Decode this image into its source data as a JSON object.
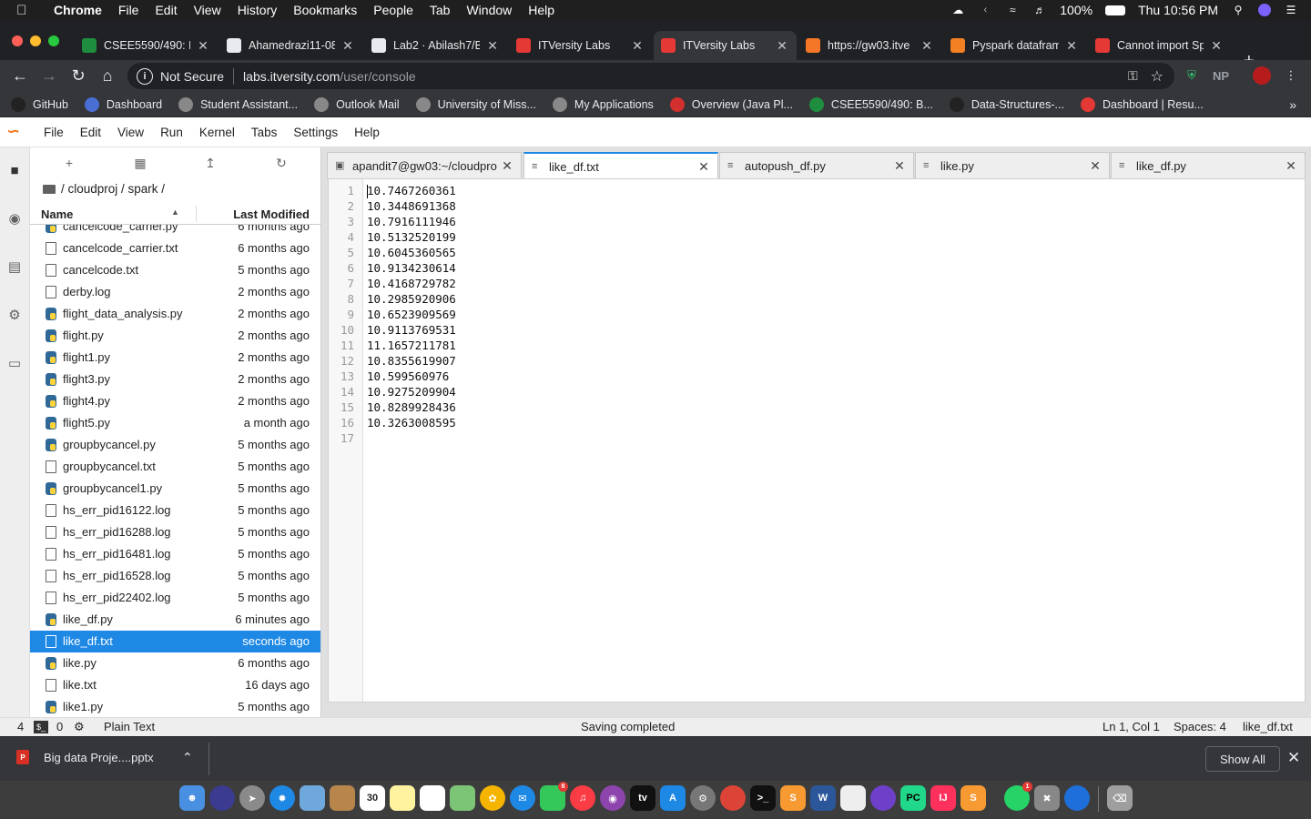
{
  "menubar": {
    "app": "Chrome",
    "items": [
      "File",
      "Edit",
      "View",
      "History",
      "Bookmarks",
      "People",
      "Tab",
      "Window",
      "Help"
    ],
    "battery": "100%",
    "clock": "Thu 10:56 PM"
  },
  "browser": {
    "tabs": [
      {
        "title": "CSEE5590/490: B",
        "favicon": "green-sheet-icon",
        "color": "#1e8e3e"
      },
      {
        "title": "Ahamedrazi11-08",
        "favicon": "github-icon",
        "color": "#e8eaed"
      },
      {
        "title": "Lab2 · Abilash7/B",
        "favicon": "github-icon",
        "color": "#e8eaed"
      },
      {
        "title": "ITVersity Labs",
        "favicon": "itversity-icon",
        "color": "#e53935"
      },
      {
        "title": "ITVersity Labs",
        "favicon": "itversity-icon",
        "color": "#e53935"
      },
      {
        "title": "https://gw03.itve",
        "favicon": "loading-icon",
        "color": "#f37726"
      },
      {
        "title": "Pyspark datafram",
        "favicon": "stackoverflow-icon",
        "color": "#f48024"
      },
      {
        "title": "Cannot import Sp",
        "favicon": "itversity-icon",
        "color": "#e53935"
      }
    ],
    "active_tab_index": 4,
    "address": {
      "security": "Not Secure",
      "host": "labs.itversity.com",
      "path": "/user/console"
    },
    "extensions": [
      "NP"
    ],
    "bookmarks": [
      {
        "label": "GitHub",
        "icon": "github-icon"
      },
      {
        "label": "Dashboard",
        "icon": "dashboard-icon"
      },
      {
        "label": "Student Assistant...",
        "icon": "globe-icon"
      },
      {
        "label": "Outlook Mail",
        "icon": "globe-icon"
      },
      {
        "label": "University of Miss...",
        "icon": "globe-icon"
      },
      {
        "label": "My Applications",
        "icon": "globe-icon"
      },
      {
        "label": "Overview (Java Pl...",
        "icon": "oracle-icon"
      },
      {
        "label": "CSEE5590/490: B...",
        "icon": "green-sheet-icon"
      },
      {
        "label": "Data-Structures-...",
        "icon": "github-icon"
      },
      {
        "label": "Dashboard | Resu...",
        "icon": "g-icon"
      }
    ]
  },
  "jupyter": {
    "menu": [
      "File",
      "Edit",
      "View",
      "Run",
      "Kernel",
      "Tabs",
      "Settings",
      "Help"
    ],
    "breadcrumb": "/ cloudproj / spark /",
    "columns": {
      "name": "Name",
      "modified": "Last Modified"
    },
    "files": [
      {
        "name": "cancelcode_carrier.py",
        "type": "py",
        "modified": "6 months ago"
      },
      {
        "name": "cancelcode_carrier.txt",
        "type": "txt",
        "modified": "6 months ago"
      },
      {
        "name": "cancelcode.txt",
        "type": "txt",
        "modified": "5 months ago"
      },
      {
        "name": "derby.log",
        "type": "txt",
        "modified": "2 months ago"
      },
      {
        "name": "flight_data_analysis.py",
        "type": "py",
        "modified": "2 months ago"
      },
      {
        "name": "flight.py",
        "type": "py",
        "modified": "2 months ago"
      },
      {
        "name": "flight1.py",
        "type": "py",
        "modified": "2 months ago"
      },
      {
        "name": "flight3.py",
        "type": "py",
        "modified": "2 months ago"
      },
      {
        "name": "flight4.py",
        "type": "py",
        "modified": "2 months ago"
      },
      {
        "name": "flight5.py",
        "type": "py",
        "modified": "a month ago"
      },
      {
        "name": "groupbycancel.py",
        "type": "py",
        "modified": "5 months ago"
      },
      {
        "name": "groupbycancel.txt",
        "type": "txt",
        "modified": "5 months ago"
      },
      {
        "name": "groupbycancel1.py",
        "type": "py",
        "modified": "5 months ago"
      },
      {
        "name": "hs_err_pid16122.log",
        "type": "txt",
        "modified": "5 months ago"
      },
      {
        "name": "hs_err_pid16288.log",
        "type": "txt",
        "modified": "5 months ago"
      },
      {
        "name": "hs_err_pid16481.log",
        "type": "txt",
        "modified": "5 months ago"
      },
      {
        "name": "hs_err_pid16528.log",
        "type": "txt",
        "modified": "5 months ago"
      },
      {
        "name": "hs_err_pid22402.log",
        "type": "txt",
        "modified": "5 months ago"
      },
      {
        "name": "like_df.py",
        "type": "py",
        "modified": "6 minutes ago"
      },
      {
        "name": "like_df.txt",
        "type": "txt",
        "modified": "seconds ago",
        "selected": true
      },
      {
        "name": "like.py",
        "type": "py",
        "modified": "6 months ago"
      },
      {
        "name": "like.txt",
        "type": "txt",
        "modified": "16 days ago"
      },
      {
        "name": "like1.py",
        "type": "py",
        "modified": "5 months ago"
      }
    ],
    "editor_tabs": [
      {
        "label": "apandit7@gw03:~/cloudpro",
        "icon": "terminal-icon"
      },
      {
        "label": "like_df.txt",
        "icon": "text-file-icon",
        "active": true
      },
      {
        "label": "autopush_df.py",
        "icon": "text-file-icon"
      },
      {
        "label": "like.py",
        "icon": "text-file-icon"
      },
      {
        "label": "like_df.py",
        "icon": "text-file-icon"
      }
    ],
    "lines": [
      "10.7467260361",
      "10.3448691368",
      "10.7916111946",
      "10.5132520199",
      "10.6045360565",
      "10.9134230614",
      "10.4168729782",
      "10.2985920906",
      "10.6523909569",
      "10.9113769531",
      "11.1657211781",
      "10.8355619907",
      "10.599560976",
      "10.9275209904",
      "10.8289928436",
      "10.3263008595",
      ""
    ],
    "status": {
      "left_count1": "4",
      "left_count2": "0",
      "mode": "Plain Text",
      "message": "Saving completed",
      "position": "Ln 1, Col 1",
      "spaces": "Spaces: 4",
      "filename": "like_df.txt"
    }
  },
  "downloads": {
    "item": "Big data Proje....pptx",
    "show_all": "Show All"
  },
  "dock": {
    "calendar_day": "30",
    "badges": {
      "messages": "8",
      "whatsapp": "1"
    }
  }
}
